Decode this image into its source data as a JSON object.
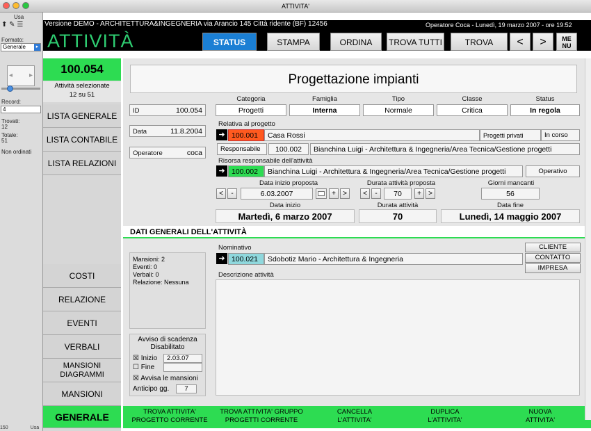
{
  "window": {
    "title": "ATTIVITA'"
  },
  "header": {
    "demo_line": "Versione DEMO - ARCHITETTURA&INGEGNERIA via Arancio 145 Città ridente (BF) 12456",
    "operator_line": "Operatore Coca - Lunedì, 19 marzo 2007 - ore 19:52",
    "app_title": "ATTIVITÀ",
    "nav": [
      "STATUS",
      "STAMPA",
      "ORDINA",
      "TROVA TUTTI",
      "TROVA",
      "<",
      ">",
      "ME NU"
    ]
  },
  "palette": {
    "top_label": "Usa",
    "format_label": "Formato:",
    "format_value": "Generale",
    "record_label": "Record:",
    "record_value": "4",
    "found_label": "Trovati:",
    "found_value": "12",
    "total_label": "Totale:",
    "total_value": "51",
    "unsorted": "Non ordinati",
    "zoom": "150",
    "mode": "Usa"
  },
  "record": {
    "number": "100.054",
    "selected_label": "Attività selezionate",
    "selected_count": "12 su 51"
  },
  "left_nav": {
    "lista_generale": "LISTA GENERALE",
    "lista_contabile": "LISTA CONTABILE",
    "lista_relazioni": "LISTA RELAZIONI",
    "costi": "COSTI",
    "relazione": "RELAZIONE",
    "eventi": "EVENTI",
    "verbali": "VERBALI",
    "mansioni_diagrammi": "MANSIONI DIAGRAMMI",
    "mansioni": "MANSIONI",
    "generale": "GENERALE"
  },
  "main": {
    "title": "Progettazione impianti",
    "id_label": "ID",
    "id_value": "100.054",
    "data_label": "Data",
    "data_value": "11.8.2004",
    "operatore_label": "Operatore",
    "operatore_value": "coca",
    "categoria_label": "Categoria",
    "categoria_value": "Progetti",
    "famiglia_label": "Famiglia",
    "famiglia_value": "Interna",
    "tipo_label": "Tipo",
    "tipo_value": "Normale",
    "classe_label": "Classe",
    "classe_value": "Critica",
    "status_label": "Status",
    "status_value": "In regola",
    "progetto_label": "Relativa al progetto",
    "progetto_code": "100.001",
    "progetto_name": "Casa Rossi",
    "progetto_tipo": "Progetti privati",
    "progetto_stato": "In corso",
    "responsabile_label": "Responsabile",
    "responsabile_code": "100.002",
    "responsabile_name": "Bianchina Luigi - Architettura & Ingegneria/Area Tecnica/Gestione progetti",
    "risorsa_label": "Risorsa responsabile dell'attività",
    "risorsa_code": "100.002",
    "risorsa_name": "Bianchina Luigi - Architettura & Ingegneria/Area Tecnica/Gestione progetti",
    "risorsa_stato": "Operativo",
    "data_inizio_proposta_label": "Data inizio proposta",
    "data_inizio_proposta_value": "6.03.2007",
    "durata_proposta_label": "Durata attività proposta",
    "durata_proposta_value": "70",
    "giorni_mancanti_label": "Giorni mancanti",
    "giorni_mancanti_value": "56",
    "data_inizio_label": "Data inizio",
    "data_inizio_value": "Martedì, 6 marzo 2007",
    "durata_label": "Durata attività",
    "durata_value": "70",
    "data_fine_label": "Data fine",
    "data_fine_value": "Lunedì, 14 maggio 2007",
    "btn_lt": "<",
    "btn_minus": "-",
    "btn_plus": "+",
    "btn_gt": ">"
  },
  "section": {
    "heading": "DATI GENERALI DELL'ATTIVITÀ",
    "mansioni": "Mansioni: 2",
    "eventi": "Eventi:    0",
    "verbali": "Verbali:   0",
    "relazione": "Relazione: Nessuna",
    "nominativo_label": "Nominativo",
    "nominativo_code": "100.021",
    "nominativo_name": "Sdobotiz Mario - Architettura & Ingegneria",
    "descrizione_label": "Descrizione attività",
    "btn_cliente": "CLIENTE",
    "btn_contatto": "CONTATTO",
    "btn_impresa": "IMPRESA",
    "avviso_title": "Avviso di scadenza",
    "avviso_state": "Disabilitato",
    "inizio_label": "Inizio",
    "inizio_value": "2.03.07",
    "fine_label": "Fine",
    "avvisa_label": "Avvisa le mansioni",
    "anticipo_label": "Anticipo gg.",
    "anticipo_value": "7"
  },
  "bottom": {
    "trova_attivita": "TROVA ATTIVITA' PROGETTO CORRENTE",
    "trova_gruppo": "TROVA ATTIVITA' GRUPPO PROGETTI CORRENTE",
    "cancella": "CANCELLA L'ATTIVITA'",
    "duplica": "DUPLICA L'ATTIVITA'",
    "nuova": "NUOVA ATTIVITA'"
  },
  "colors": {
    "accent_green": "#2ddc52",
    "status_blue": "#1b7fd4",
    "project_red": "#ff5a1f",
    "contact_teal": "#8fd8dd"
  }
}
